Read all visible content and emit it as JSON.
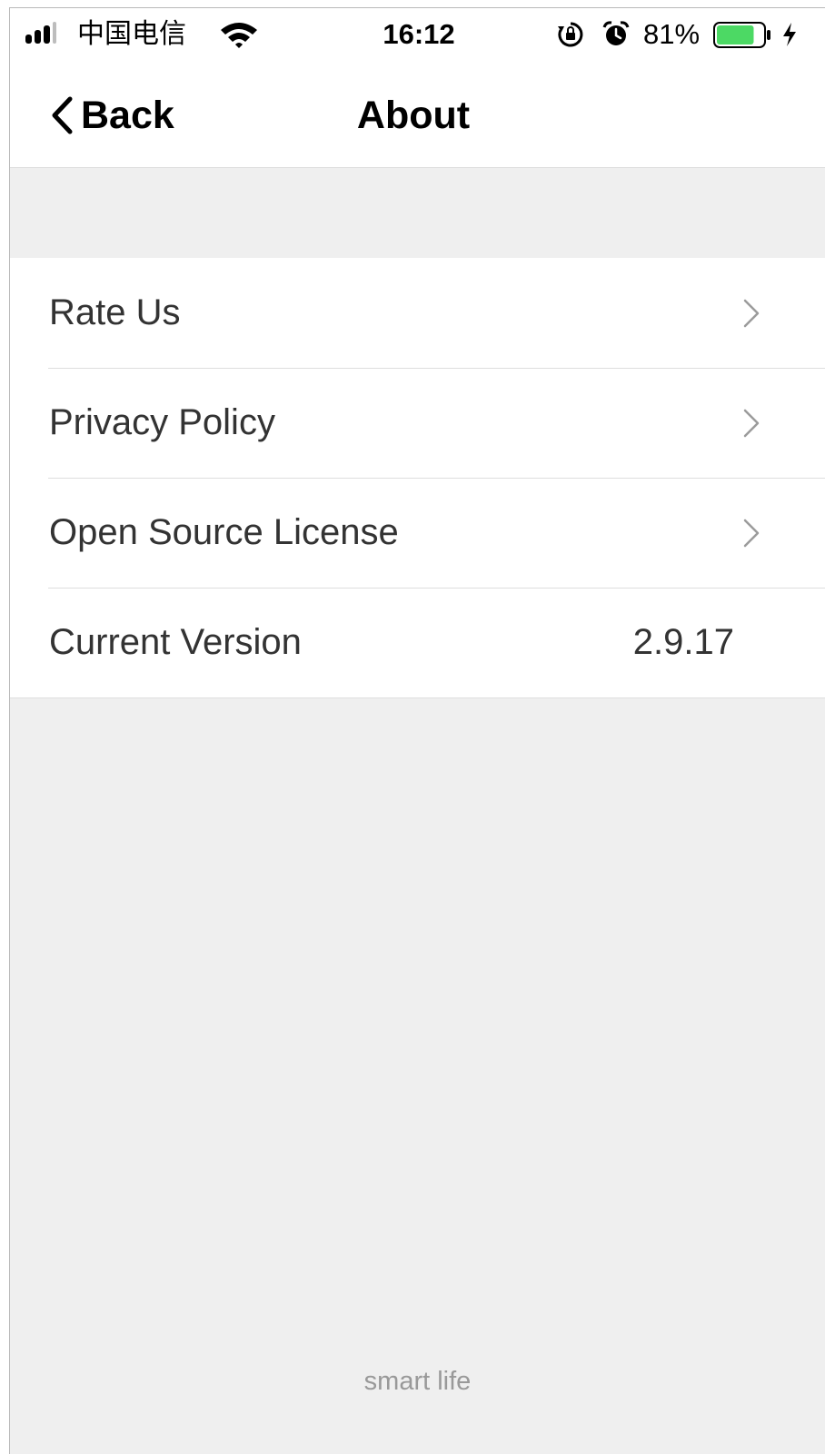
{
  "status_bar": {
    "carrier": "中国电信",
    "time": "16:12",
    "battery_percent": "81%",
    "battery_level": 0.81,
    "battery_color": "#4cd964",
    "icons": [
      "signal-icon",
      "wifi-icon",
      "rotation-lock-icon",
      "alarm-icon",
      "battery-icon",
      "charging-bolt-icon"
    ]
  },
  "nav": {
    "back_label": "Back",
    "title": "About"
  },
  "settings": {
    "items": [
      {
        "label": "Rate Us"
      },
      {
        "label": "Privacy Policy"
      },
      {
        "label": "Open Source License"
      },
      {
        "label": "Current Version",
        "value": "2.9.17"
      }
    ]
  },
  "footer": {
    "label": "smart life"
  }
}
